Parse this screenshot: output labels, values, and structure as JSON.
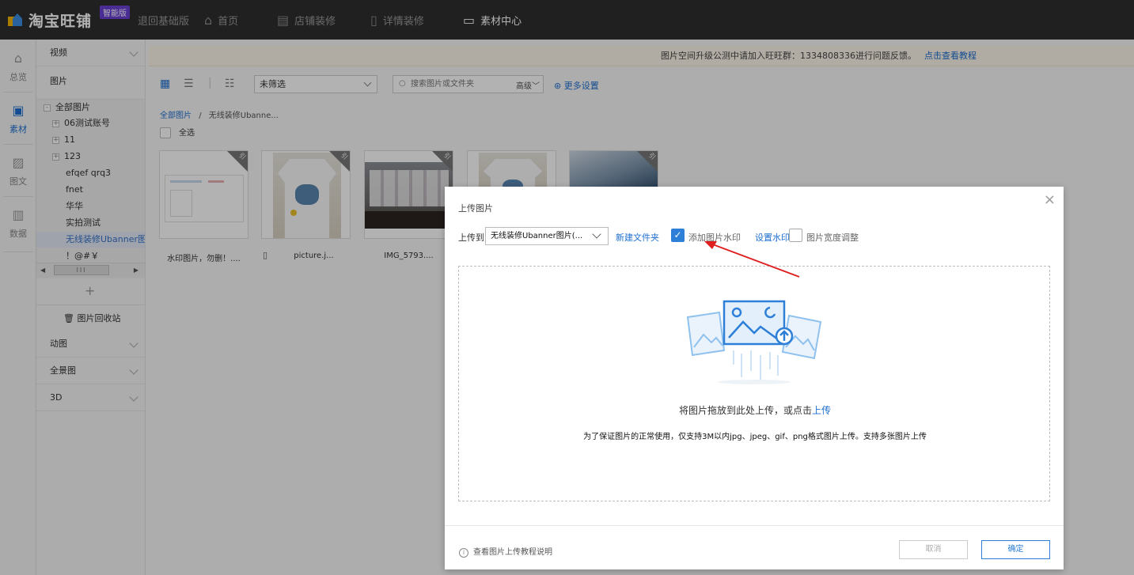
{
  "topbar": {
    "logo_text": "淘宝旺铺",
    "logo_badge": "智能版",
    "back_basic": "退回基础版",
    "nav": [
      {
        "label": "首页",
        "icon": "home-icon"
      },
      {
        "label": "店铺装修",
        "icon": "shop-icon"
      },
      {
        "label": "详情装修",
        "icon": "document-icon"
      },
      {
        "label": "素材中心",
        "icon": "folder-icon",
        "active": true
      }
    ]
  },
  "rail": [
    {
      "label": "总览",
      "icon": "overview-icon"
    },
    {
      "label": "素材",
      "icon": "material-icon",
      "active": true
    },
    {
      "label": "图文",
      "icon": "image-text-icon"
    },
    {
      "label": "数据",
      "icon": "data-icon"
    }
  ],
  "sidebar": {
    "video": "视频",
    "pictures": "图片",
    "tree": [
      {
        "label": "全部图片",
        "expander": "-"
      },
      {
        "label": "06测试账号",
        "expander": "+"
      },
      {
        "label": "11",
        "expander": "+"
      },
      {
        "label": "123",
        "expander": "+"
      },
      {
        "label": "efqef qrq3"
      },
      {
        "label": "fnet"
      },
      {
        "label": "华华"
      },
      {
        "label": "实拍测试"
      },
      {
        "label": "无线装修Ubanner图片",
        "selected": true
      },
      {
        "label": "！@#￥"
      }
    ],
    "scroll_thumb": "III",
    "add": "+",
    "recycle": "图片回收站",
    "animated": "动图",
    "panorama": "全景图",
    "three_d": "3D"
  },
  "notice": {
    "text": "图片空间升级公测中请加入旺旺群：1334808336进行问题反馈。",
    "link": "点击查看教程"
  },
  "toolbar": {
    "filter_value": "未筛选",
    "search_placeholder": "搜索图片或文件夹",
    "advanced": "高级",
    "more_settings": "更多设置"
  },
  "breadcrumb": {
    "root": "全部图片",
    "sep": "/",
    "current": "无线装修Ubanne..."
  },
  "select_all": "全选",
  "thumbnails": [
    {
      "caption": "水印图片，勿删！....",
      "corner": "引"
    },
    {
      "caption": "picture.j...",
      "corner": "引"
    },
    {
      "caption": "IMG_5793....",
      "corner": "引"
    },
    {
      "caption": "",
      "corner": ""
    },
    {
      "caption": "",
      "corner": "引"
    }
  ],
  "modal": {
    "title": "上传图片",
    "close": "×",
    "upload_to_label": "上传到",
    "folder_value": "无线装修Ubanner图片(...",
    "new_folder": "新建文件夹",
    "watermark_checked": true,
    "watermark_label": "添加图片水印",
    "watermark_settings": "设置水印",
    "width_adjust_label": "图片宽度调整",
    "drop_text": "将图片拖放到此处上传，或点击",
    "drop_link": "上传",
    "drop_hint": "为了保证图片的正常使用，仅支持3M以内jpg、jpeg、gif、png格式图片上传。支持多张图片上传",
    "help": "查看图片上传教程说明",
    "cancel": "取消",
    "ok": "确定"
  },
  "colors": {
    "accent": "#2d7fd8",
    "topbar": "#2e2e2e",
    "annotation_arrow": "#e02020"
  }
}
